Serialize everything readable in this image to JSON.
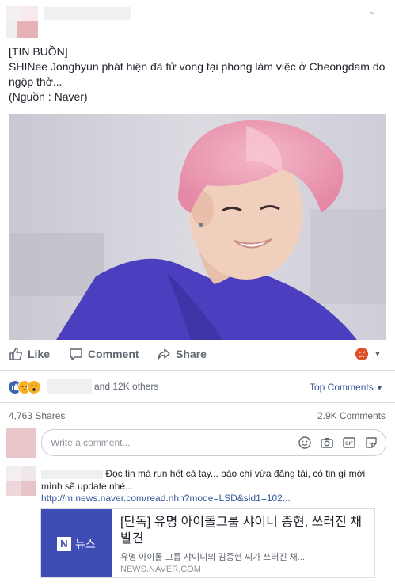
{
  "post": {
    "line1": "[TIN BUỒN]",
    "line2": "SHINee Jonghyun phát hiện đã tử vong tại phòng làm việc ở Cheongdam do ngộp thở...",
    "line3": "(Nguồn : Naver)"
  },
  "actions": {
    "like": "Like",
    "comment": "Comment",
    "share": "Share"
  },
  "reactions": {
    "others_text": "and 12K others",
    "top_comments": "Top Comments",
    "shares": "4,763 Shares",
    "comments": "2.9K Comments"
  },
  "comment_box": {
    "placeholder": "Write a comment..."
  },
  "comment": {
    "text": "Đọc tin mà run hết cả tay... báo chí vừa đăng tải, có tin gì mới mình sẽ update nhé...",
    "link": "http://m.news.naver.com/read.nhn?mode=LSD&sid1=102..."
  },
  "preview": {
    "logo_letter": "N",
    "logo_word": "뉴스",
    "title": "[단독] 유명 아이돌그룹 샤이니 종현, 쓰러진 채 발견",
    "desc": "유명 아이돌 그룹 샤이니의 김종현 씨가 쓰러진 채...",
    "domain": "NEWS.NAVER.COM"
  },
  "colors": {
    "link": "#385898",
    "accent": "#365899",
    "naver_blue": "#3d4db3",
    "like_blue": "#4267b2"
  }
}
